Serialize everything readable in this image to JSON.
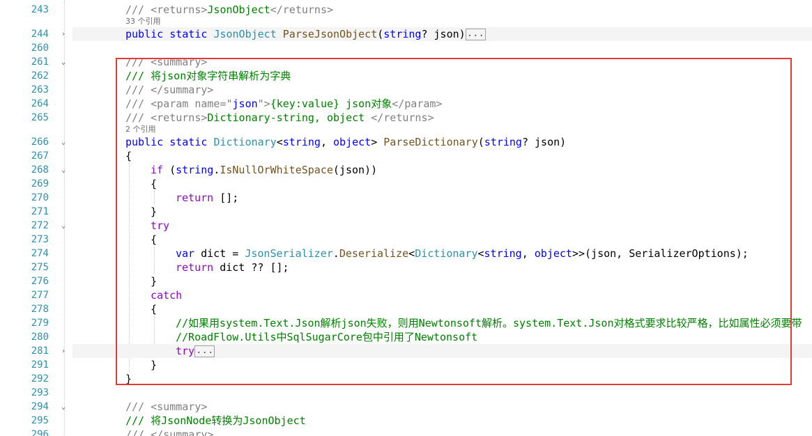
{
  "codelens": [
    {
      "id": "ref1",
      "text": "33 个引用"
    },
    {
      "id": "ref2",
      "text": "2 个引用"
    }
  ],
  "lines": {
    "l243": {
      "num": "243",
      "a": "/// ",
      "b": "<returns>",
      "c": "JsonObject",
      "d": "</returns>"
    },
    "l244": {
      "num": "244",
      "kw1": "public",
      "kw2": "static",
      "type": "JsonObject",
      "method": "ParseJsonObject",
      "p1": "(",
      "kw3": "string",
      "p2": "? json)",
      "ellipsis": "..."
    },
    "l260": {
      "num": "260"
    },
    "l261": {
      "num": "261",
      "a": "/// ",
      "b": "<summary>"
    },
    "l262": {
      "num": "262",
      "a": "/// 将json对象字符串解析为字典"
    },
    "l263": {
      "num": "263",
      "a": "/// ",
      "b": "</summary>"
    },
    "l264": {
      "num": "264",
      "a": "/// ",
      "b": "<param name=\"",
      "c": "json",
      "d": "\">",
      "e": "{key:value} json对象",
      "f": "</param>"
    },
    "l265": {
      "num": "265",
      "a": "/// ",
      "b": "<returns>",
      "c": "Dictionary-string, object ",
      "d": "</returns>"
    },
    "l266": {
      "num": "266",
      "kw1": "public",
      "kw2": "static",
      "type": "Dictionary",
      "t1": "<",
      "kw3": "string",
      "t2": ", ",
      "kw4": "object",
      "t3": "> ",
      "method": "ParseDictionary",
      "t4": "(",
      "kw5": "string",
      "t5": "? json)"
    },
    "l267": {
      "num": "267",
      "a": "{"
    },
    "l268": {
      "num": "268",
      "kw1": "if",
      "t1": " (",
      "kw2": "string",
      "t2": ".",
      "method": "IsNullOrWhiteSpace",
      "t3": "(json))"
    },
    "l269": {
      "num": "269",
      "a": "{"
    },
    "l270": {
      "num": "270",
      "kw1": "return",
      "t1": " [];"
    },
    "l271": {
      "num": "271",
      "a": "}"
    },
    "l272": {
      "num": "272",
      "kw1": "try"
    },
    "l273": {
      "num": "273",
      "a": "{"
    },
    "l274": {
      "num": "274",
      "kw1": "var",
      "t1": " dict = ",
      "type1": "JsonSerializer",
      "t2": ".",
      "method": "Deserialize",
      "t3": "<",
      "type2": "Dictionary",
      "t4": "<",
      "kw2": "string",
      "t5": ", ",
      "kw3": "object",
      "t6": ">>(json, SerializerOptions);"
    },
    "l275": {
      "num": "275",
      "kw1": "return",
      "t1": " dict ?? [];"
    },
    "l276": {
      "num": "276",
      "a": "}"
    },
    "l277": {
      "num": "277",
      "kw1": "catch"
    },
    "l278": {
      "num": "278",
      "a": "{"
    },
    "l279": {
      "num": "279",
      "a": "//如果用system.Text.Json解析json失败，则用Newtonsoft解析。system.Text.Json对格式要求比较严格，比如属性必须要带"
    },
    "l280": {
      "num": "280",
      "a": "//RoadFlow.Utils中SqlSugarCore包中引用了Newtonsoft"
    },
    "l281": {
      "num": "281",
      "kw1": "try",
      "ellipsis": "..."
    },
    "l291": {
      "num": "291",
      "a": "}"
    },
    "l292": {
      "num": "292",
      "a": "}"
    },
    "l293": {
      "num": "293"
    },
    "l294": {
      "num": "294",
      "a": "/// ",
      "b": "<summary>"
    },
    "l295": {
      "num": "295",
      "a": "/// 将JsonNode转换为JsonObject"
    },
    "l296": {
      "num": "296",
      "a": "/// ",
      "b": "</summary>"
    }
  },
  "fold_glyphs": {
    "expanded": "⌄",
    "collapsed": "›"
  },
  "colors": {
    "keyword": "#0000ff",
    "control": "#8f08c4",
    "type": "#2b91af",
    "method": "#74531f",
    "comment": "#008000",
    "xml": "#808080",
    "highlight": "#e53935"
  }
}
